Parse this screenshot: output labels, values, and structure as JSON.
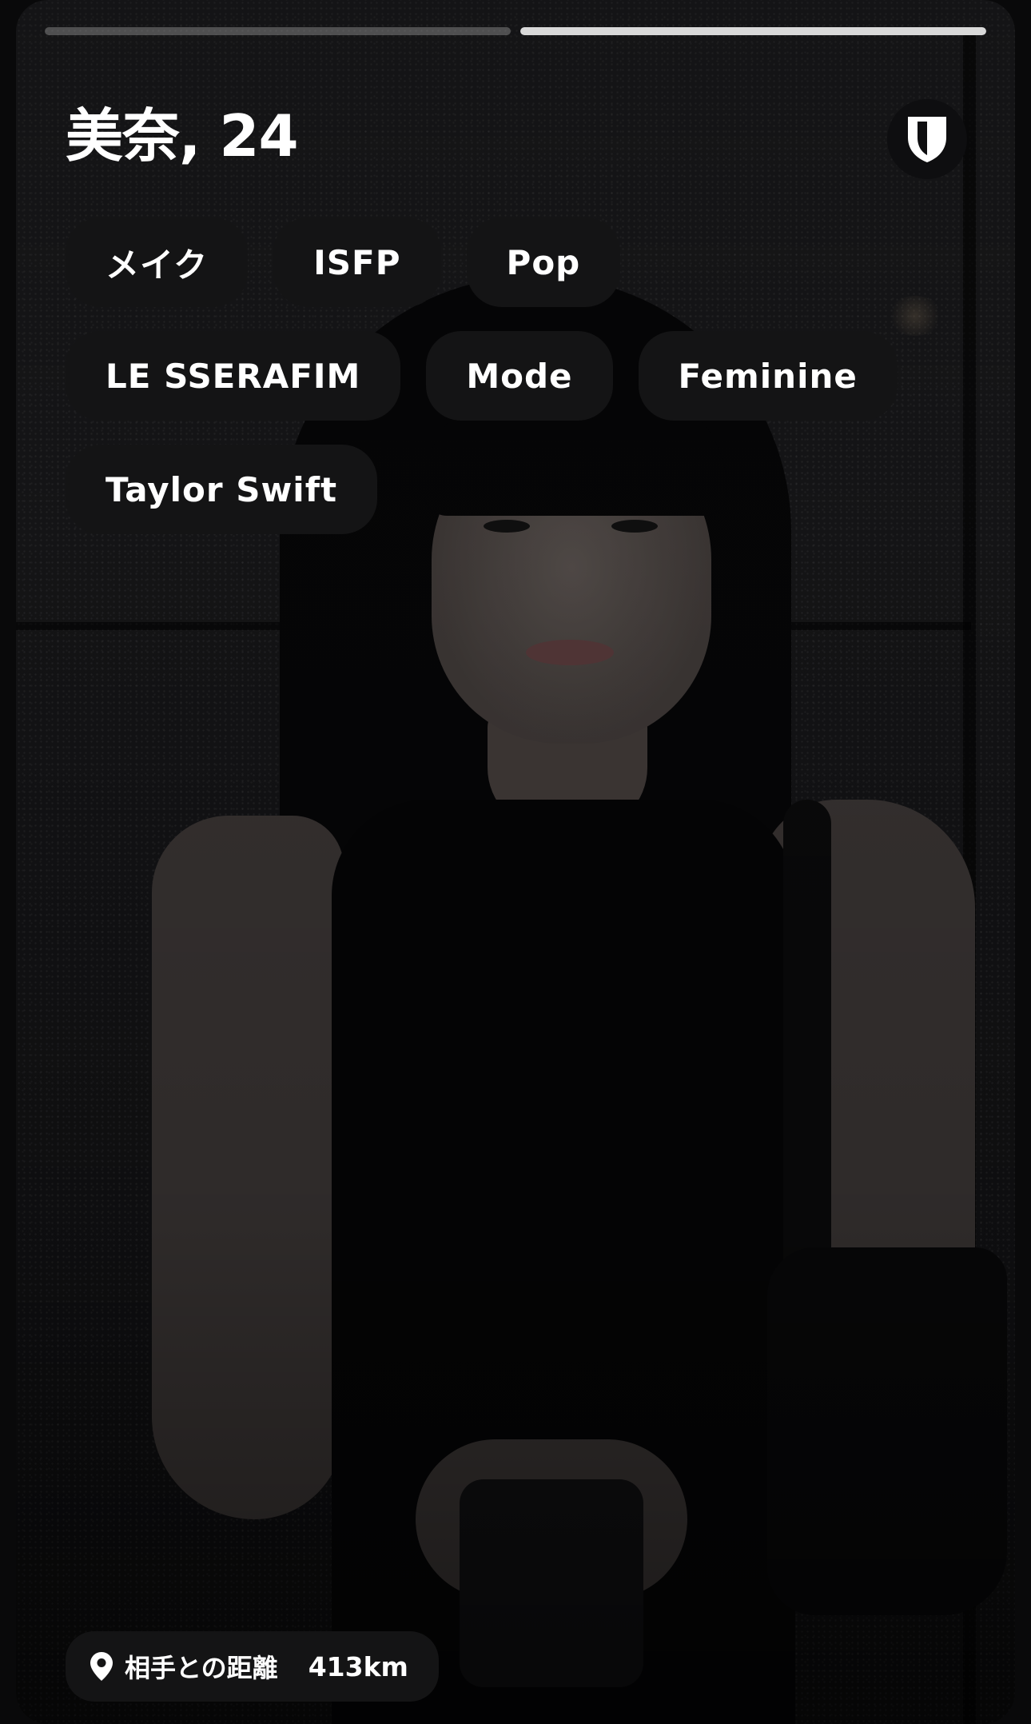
{
  "profile": {
    "title": "美奈, 24",
    "tags": [
      "メイク",
      "ISFP",
      "Pop",
      "LE SSERAFIM",
      "Mode",
      "Feminine",
      "Taylor Swift"
    ]
  },
  "photo_progress": {
    "count": 2,
    "active_index": 1,
    "fills": [
      0.0,
      1.0
    ]
  },
  "distance": {
    "icon": "location-pin-icon",
    "label": "相手との距離",
    "value": "413km"
  },
  "header_icon": "shield-icon",
  "colors": {
    "background": "#09090a",
    "pill_background": "#141415",
    "text": "#ffffff",
    "progress_active": "#d9d9d9"
  }
}
